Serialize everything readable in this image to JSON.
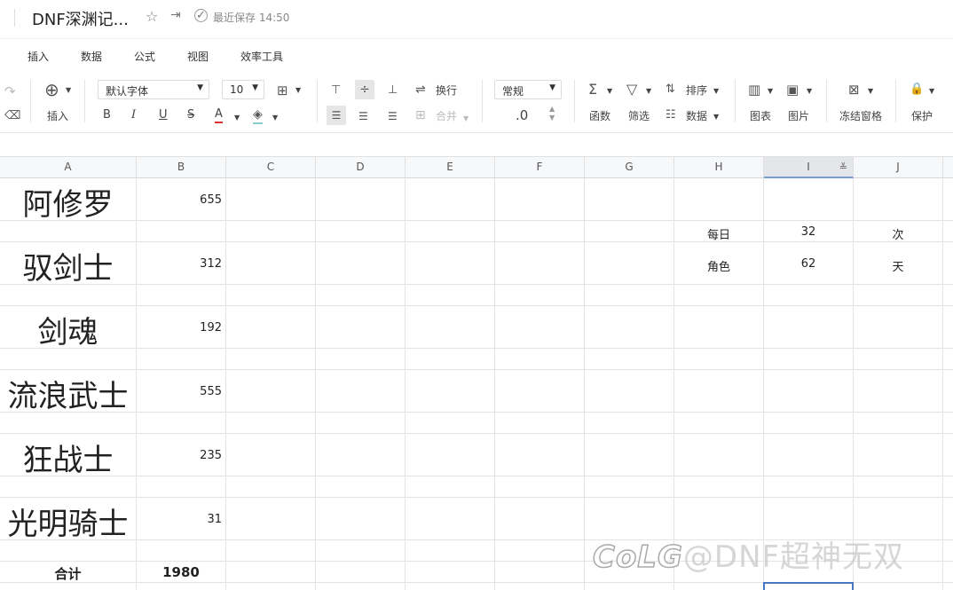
{
  "title_bar": {
    "doc_title": "DNF深渊记...",
    "star_icon": "☆",
    "move_icon": "⇥",
    "save_icon": "✓",
    "save_status": "最近保存 14:50"
  },
  "menu": {
    "tabs": [
      "插入",
      "数据",
      "公式",
      "视图",
      "效率工具"
    ]
  },
  "toolbar": {
    "redo_icon": "↷",
    "eraser_icon": "⌫",
    "insert_icon": "⊕",
    "insert_label": "插入",
    "font_family": "默认字体",
    "font_size": "10",
    "border_icon": "⊞",
    "bold": "B",
    "italic": "I",
    "underline": "U",
    "strike": "S",
    "font_color": "A",
    "fill_icon": "◈",
    "align_top": "⊤",
    "align_middle": "÷",
    "align_bottom": "⊥",
    "wrap_icon": "⇌",
    "wrap_label": "换行",
    "align_left": "☰",
    "align_center": "☰",
    "align_right": "☰",
    "merge_icon": "⊞",
    "merge_label": "合并",
    "number_format": "常规",
    "decimal_label": ".0",
    "function_icon": "Σ",
    "function_label": "函数",
    "filter_icon": "▽",
    "filter_label": "筛选",
    "sort_icon": "⇅",
    "sort_label": "排序",
    "data_icon": "☷",
    "data_label": "数据",
    "chart_icon": "▥",
    "chart_label": "图表",
    "image_icon": "▣",
    "image_label": "图片",
    "freeze_icon": "⊠",
    "freeze_label": "冻结窗格",
    "protect_icon": "🔒",
    "protect_label": "保护"
  },
  "columns": [
    "A",
    "B",
    "C",
    "D",
    "E",
    "F",
    "G",
    "H",
    "I",
    "J"
  ],
  "rows": [
    {
      "name": "阿修罗",
      "value": "655"
    },
    {
      "name": "驭剑士",
      "value": "312"
    },
    {
      "name": "剑魂",
      "value": "192"
    },
    {
      "name": "流浪武士",
      "value": "555"
    },
    {
      "name": "狂战士",
      "value": "235"
    },
    {
      "name": "光明骑士",
      "value": "31"
    }
  ],
  "total": {
    "label": "合计",
    "value": "1980"
  },
  "side_table": [
    {
      "label": "每日",
      "value": "32",
      "unit": "次"
    },
    {
      "label": "角色",
      "value": "62",
      "unit": "天"
    }
  ],
  "watermark": {
    "logo": "CoLG",
    "text": "@DNF超神无双"
  },
  "colors": {
    "selection": "#4a77c5",
    "header_bg": "#f7f8fa"
  }
}
